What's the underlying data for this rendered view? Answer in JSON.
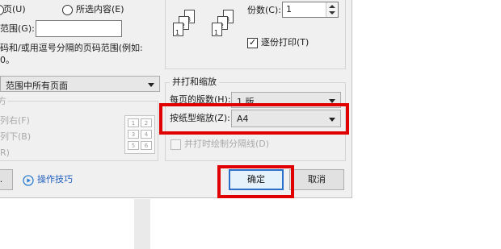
{
  "range": {
    "page_radio_label": "页(U)",
    "selection_radio_label": "所选内容(E)",
    "page_range_label": "范围(G):",
    "page_range_value": "",
    "hint_line1": "码和/或用逗号分隔的页码范围(例如:",
    "hint_line2": "0。"
  },
  "copies": {
    "label": "份数(C):",
    "value": "1",
    "collate_label": "逐份打印(T)",
    "collate_checked": true,
    "page_numbers": [
      "3",
      "2",
      "1",
      "3",
      "2",
      "1"
    ]
  },
  "print_select": {
    "value": "范围中所有页面"
  },
  "left_disabled": {
    "fragment_top": "方",
    "option1": "列右(F)",
    "option2": "列下(B)",
    "option3": "R)",
    "preview_cells": [
      "1",
      "2",
      "3",
      "4",
      "5",
      "6"
    ]
  },
  "zoom": {
    "title": "并打和缩放",
    "pages_per_sheet_label": "每页的版数(H):",
    "pages_per_sheet_value": "1 版",
    "scale_label": "按纸型缩放(Z):",
    "scale_value": "A4",
    "draw_borders_label": "并打时绘制分隔线(D)"
  },
  "footer": {
    "options_button": "...",
    "tips_label": "操作技巧",
    "ok_button": "确定",
    "cancel_button": "取消"
  },
  "colors": {
    "highlight_red": "#e00000",
    "accent_blue": "#2a6fc9",
    "dialog_bg": "#f0f0f0"
  },
  "icons": {
    "tips": "play-circle-icon",
    "dropdown": "chevron-down-icon",
    "spinner": "spin-arrows-icon",
    "collate": "collate-pages-icon",
    "layout": "page-layout-preview-icon"
  }
}
